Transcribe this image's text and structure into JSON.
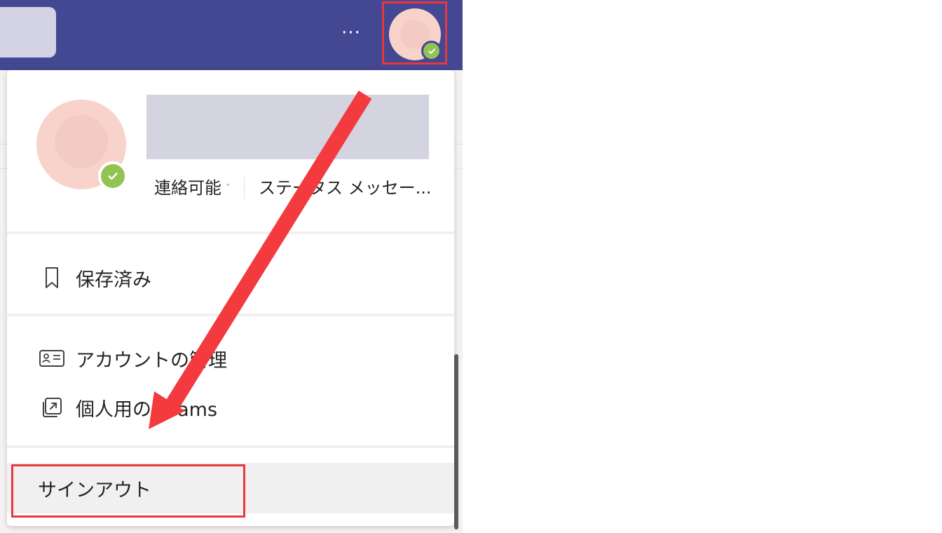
{
  "header": {
    "more_label": "···"
  },
  "profile": {
    "status_label": "連絡可能",
    "status_chevron": "˅",
    "status_message": "ステータス メッセー..."
  },
  "menu": {
    "saved_label": "保存済み",
    "manage_account_label": "アカウントの管理",
    "personal_teams_label": "個人用の Teams",
    "signout_label": "サインアウト"
  },
  "colors": {
    "header_bg": "#444791",
    "presence_available": "#92c353",
    "annotation_red": "#e8383d"
  },
  "icons": {
    "saved": "bookmark-icon",
    "manage_account": "id-card-icon",
    "personal_teams": "external-link-icon",
    "presence": "checkmark-icon"
  }
}
